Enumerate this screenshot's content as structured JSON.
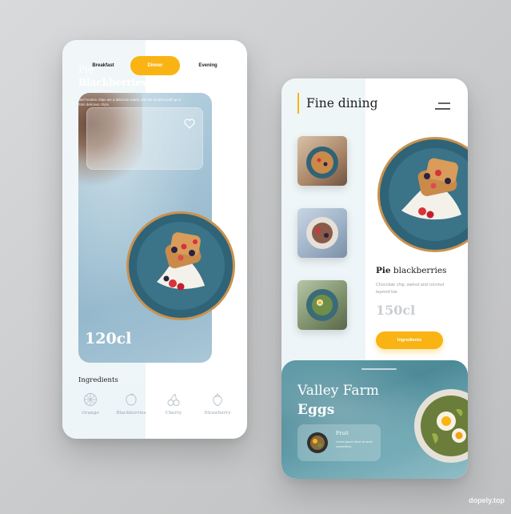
{
  "left_screen": {
    "tabs": [
      {
        "label": "Breakfast",
        "active": false
      },
      {
        "label": "Dinner",
        "active": true
      },
      {
        "label": "Evening",
        "active": false
      }
    ],
    "hero": {
      "title_line1": "Pie",
      "title_line2": "Blackberries",
      "description": "Beef tendon chips are a delicious snack, and the tendons puff up to form delicious chips.",
      "volume": "120cl"
    },
    "ingredients": {
      "title": "Ingredients",
      "items": [
        {
          "label": "Orange",
          "icon": "orange-icon"
        },
        {
          "label": "Blackberries",
          "icon": "blackberry-icon"
        },
        {
          "label": "Cherry",
          "icon": "cherry-icon"
        },
        {
          "label": "Strawberry",
          "icon": "strawberry-icon"
        }
      ]
    }
  },
  "right_screen": {
    "title": "Fine dining",
    "dish": {
      "name_bold": "Pie",
      "name_rest": " blackberries",
      "description": "Chocolate chip, walnut and coconut layered bar.",
      "volume": "150cl",
      "button_label": "Ingredients"
    },
    "bottom_card": {
      "title_line1": "Valley Farm",
      "title_line2": "Eggs",
      "mini_label": "Fruit",
      "mini_desc": "Lorem ipsum dolor sit amet consectetur"
    }
  },
  "watermark": "dopely.top",
  "colors": {
    "accent": "#f9b414",
    "plate": "#2f6377",
    "text_dark": "#1e1e1e",
    "text_muted": "#9aa6ad"
  }
}
